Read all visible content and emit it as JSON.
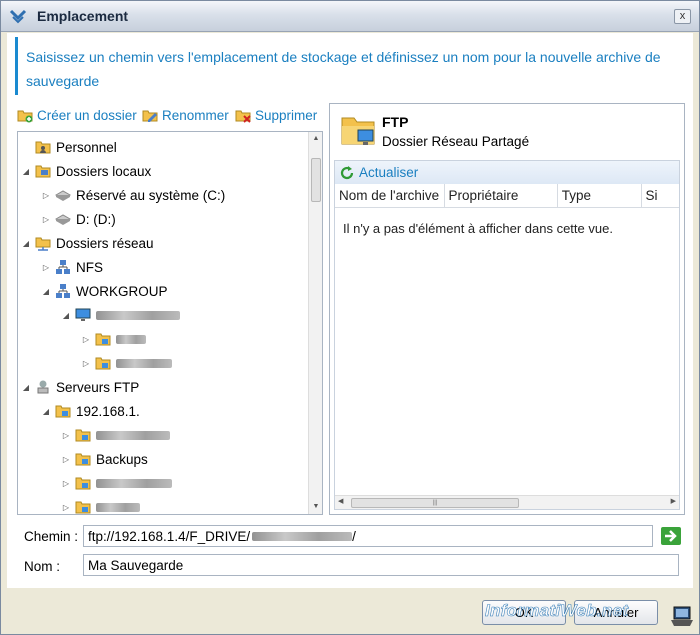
{
  "window": {
    "title": "Emplacement",
    "close_glyph": "x"
  },
  "info": {
    "text": "Saisissez un chemin vers l'emplacement de stockage et définissez un nom pour la nouvelle archive de sauvegarde"
  },
  "toolbar": {
    "create": "Créer un dossier",
    "rename": "Renommer",
    "delete": "Supprimer"
  },
  "tree": {
    "items": [
      {
        "label": "Personnel",
        "icon": "user-folder-icon"
      },
      {
        "label": "Dossiers locaux",
        "icon": "local-folders-icon"
      },
      {
        "label": "Réservé au système (C:)",
        "icon": "drive-icon"
      },
      {
        "label": "D: (D:)",
        "icon": "drive-icon"
      },
      {
        "label": "Dossiers réseau",
        "icon": "network-folders-icon"
      },
      {
        "label": "NFS",
        "icon": "network-icon"
      },
      {
        "label": "WORKGROUP",
        "icon": "network-icon"
      },
      {
        "label": "",
        "icon": "computer-icon"
      },
      {
        "label": "",
        "icon": "shared-folder-icon"
      },
      {
        "label": "",
        "icon": "shared-folder-icon"
      },
      {
        "label": "Serveurs FTP",
        "icon": "ftp-server-icon"
      },
      {
        "label": "192.168.1.",
        "icon": "ftp-folder-icon"
      },
      {
        "label": "",
        "icon": "shared-folder-icon"
      },
      {
        "label": "Backups",
        "icon": "shared-folder-icon"
      },
      {
        "label": "",
        "icon": "shared-folder-icon"
      },
      {
        "label": "",
        "icon": "shared-folder-icon"
      }
    ]
  },
  "details": {
    "name": "FTP",
    "subtitle": "Dossier Réseau Partagé",
    "refresh": "Actualiser",
    "columns": [
      "Nom de l'archive",
      "Propriétaire",
      "Type",
      "Si"
    ],
    "empty_message": "Il n'y a pas d'élément à afficher dans cette vue."
  },
  "form": {
    "path_label": "Chemin :",
    "path_value": "ftp://192.168.1.4/F_DRIVE/",
    "path_suffix": "/",
    "name_label": "Nom :",
    "name_value": "Ma Sauvegarde"
  },
  "buttons": {
    "ok": "OK",
    "cancel": "Annuler"
  },
  "watermark": "InformatiWeb.net",
  "colors": {
    "accent": "#1a7fc0",
    "folder": "#f3c14b",
    "go": "#3aa33a"
  }
}
